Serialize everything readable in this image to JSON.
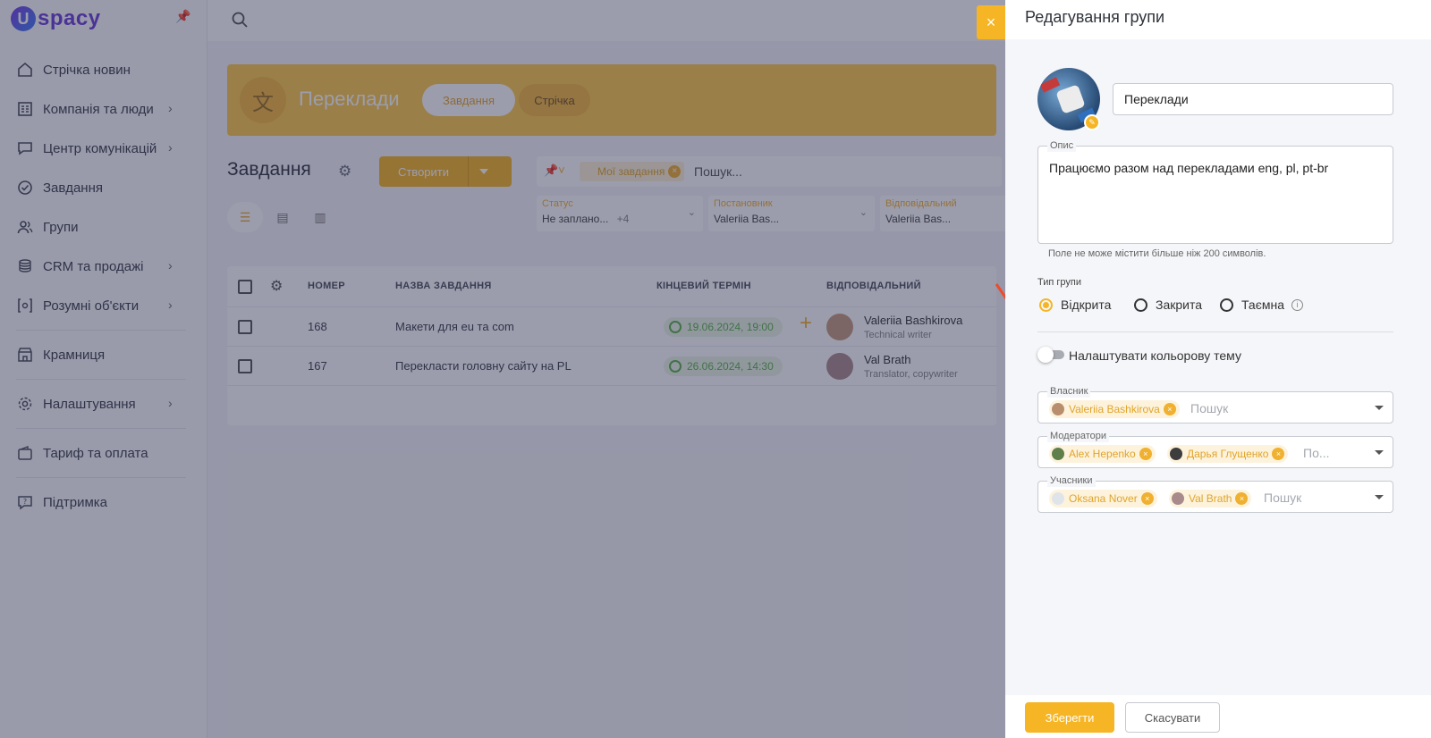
{
  "logo": {
    "mark": "U",
    "word": "spacy"
  },
  "sidebar": {
    "items": [
      {
        "label": "Стрічка новин",
        "icon": "home-icon",
        "chevron": false
      },
      {
        "label": "Компанія та люди",
        "icon": "company-icon",
        "chevron": true
      },
      {
        "label": "Центр комунікацій",
        "icon": "chat-icon",
        "chevron": true
      },
      {
        "label": "Завдання",
        "icon": "check-circle-icon",
        "chevron": false
      },
      {
        "label": "Групи",
        "icon": "users-icon",
        "chevron": false
      },
      {
        "label": "CRM та продажі",
        "icon": "coins-icon",
        "chevron": true
      },
      {
        "label": "Розумні об'єкти",
        "icon": "smart-object-icon",
        "chevron": true
      },
      {
        "label": "Крамниця",
        "icon": "store-icon",
        "chevron": false
      },
      {
        "label": "Налаштування",
        "icon": "gear-icon",
        "chevron": true
      },
      {
        "label": "Тариф та оплата",
        "icon": "wallet-icon",
        "chevron": false
      },
      {
        "label": "Підтримка",
        "icon": "help-icon",
        "chevron": false
      }
    ]
  },
  "group_banner": {
    "title": "Переклади",
    "tabs": [
      "Завдання",
      "Стрічка"
    ]
  },
  "tasks": {
    "title": "Завдання",
    "create_label": "Створити",
    "chip_mine": "Мої завдання",
    "search_placeholder": "Пошук...",
    "filters": [
      {
        "label": "Статус",
        "value": "Не заплано...",
        "extra": "+4"
      },
      {
        "label": "Постановник",
        "value": "Valeriia Bas...",
        "extra": ""
      },
      {
        "label": "Відповідальний",
        "value": "Valeriia Bas...",
        "extra": ""
      }
    ],
    "columns": [
      "НОМЕР",
      "НАЗВА ЗАВДАННЯ",
      "КІНЦЕВИЙ ТЕРМІН",
      "ВІДПОВІДАЛЬНИЙ"
    ],
    "rows": [
      {
        "number": "168",
        "name": "Макети для eu та com",
        "due": "19.06.2024, 19:00",
        "person": "Valeriia Bashkirova",
        "role": "Technical writer"
      },
      {
        "number": "167",
        "name": "Перекласти головну сайту на PL",
        "due": "26.06.2024, 14:30",
        "person": "Val Brath",
        "role": "Translator, copywriter"
      }
    ]
  },
  "drawer": {
    "title": "Редагування групи",
    "close_icon": "×",
    "name_value": "Переклади",
    "description_label": "Опис",
    "description_value": "Працюємо разом над перекладами eng, pl, pt-br",
    "description_hint": "Поле не може містити більше ніж 200 символів.",
    "group_type_label": "Тип групи",
    "group_types": [
      {
        "label": "Відкрита",
        "selected": true
      },
      {
        "label": "Закрита",
        "selected": false
      },
      {
        "label": "Таємна",
        "selected": false
      }
    ],
    "color_theme_label": "Налаштувати кольорову тему",
    "color_theme_enabled": false,
    "owner": {
      "label": "Власник",
      "chips": [
        "Valeriia Bashkirova"
      ],
      "placeholder": "Пошук"
    },
    "moderators": {
      "label": "Модератори",
      "chips": [
        "Alex Hepenko",
        "Дарья Глущенко"
      ],
      "placeholder": "По..."
    },
    "members": {
      "label": "Учасники",
      "chips": [
        "Oksana Nover",
        "Val Brath"
      ],
      "placeholder": "Пошук"
    },
    "save_label": "Зберегти",
    "cancel_label": "Скасувати"
  },
  "colors": {
    "accent": "#f5b524",
    "overlay": "rgba(35,38,70,0.45)",
    "success": "#5caf4a"
  }
}
